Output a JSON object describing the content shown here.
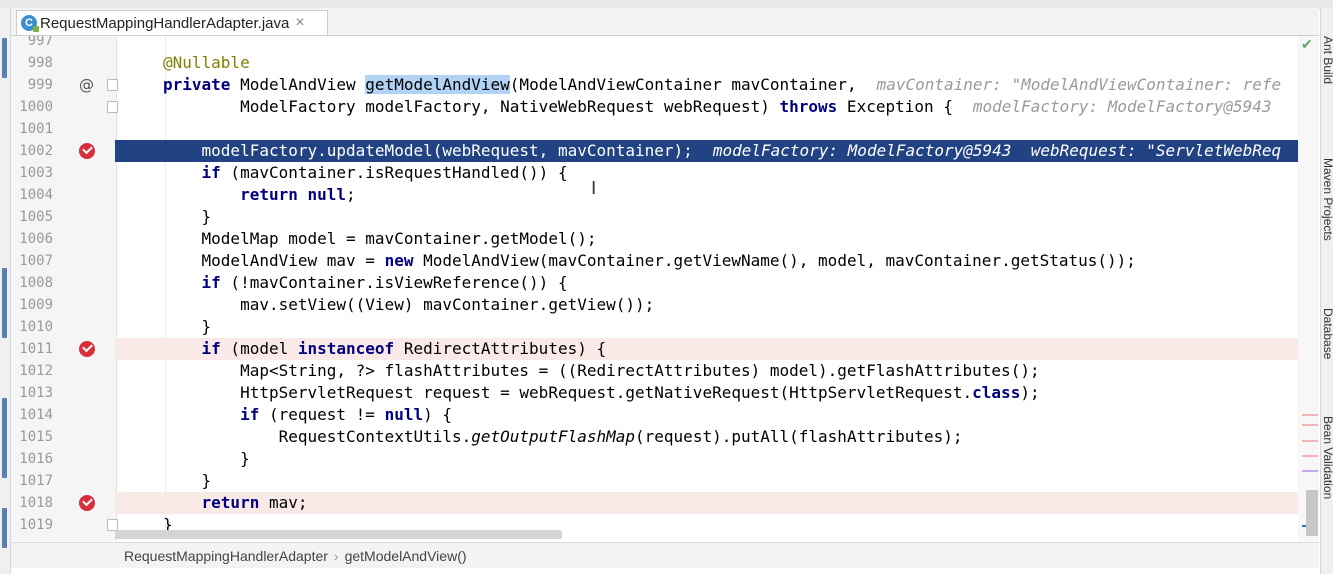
{
  "tab": {
    "icon": "java-class-icon",
    "title": "RequestMappingHandlerAdapter.java",
    "close": "×"
  },
  "editor": {
    "lines": [
      {
        "num": "997",
        "html": ""
      },
      {
        "num": "998",
        "html": "<span class=\"ann\">@Nullable</span>"
      },
      {
        "num": "999",
        "gutter_icon": "override-icon",
        "gutter_text": "@",
        "html": "<span class=\"kw\">private</span> ModelAndView <span class=\"sel\">getModelAndView</span>(ModelAndViewContainer mavContainer,<span class=\"inlay\">mavContainer: \"ModelAndViewContainer: refe</span>"
      },
      {
        "num": "1000",
        "html": "        ModelFactory modelFactory, NativeWebRequest webRequest) <span class=\"kw\">throws</span> Exception {<span class=\"inlay\">modelFactory: ModelFactory@5943</span>"
      },
      {
        "num": "1001",
        "html": ""
      },
      {
        "num": "1002",
        "gutter_icon": "breakpoint-icon",
        "highlight": true,
        "html": "    modelFactory.updateModel(webRequest, mavContainer);<span class=\"inlay\">modelFactory: ModelFactory@5943  webRequest: \"ServletWebReq</span>"
      },
      {
        "num": "1003",
        "html": "    <span class=\"kw\">if</span> (mavContainer.isRequestHandled()) {"
      },
      {
        "num": "1004",
        "html": "        <span class=\"kw\">return null</span>;"
      },
      {
        "num": "1005",
        "html": "    }"
      },
      {
        "num": "1006",
        "html": "    ModelMap model = mavContainer.getModel();"
      },
      {
        "num": "1007",
        "html": "    ModelAndView mav = <span class=\"kw\">new</span> ModelAndView(mavContainer.getViewName(), model, mavContainer.getStatus());"
      },
      {
        "num": "1008",
        "html": "    <span class=\"kw\">if</span> (!mavContainer.isViewReference()) {"
      },
      {
        "num": "1009",
        "html": "        mav.setView((View) mavContainer.getView());"
      },
      {
        "num": "1010",
        "html": "    }"
      },
      {
        "num": "1011",
        "gutter_icon": "breakpoint-icon",
        "bp": true,
        "html": "    <span class=\"kw\">if</span> (model <span class=\"kw\">instanceof</span> RedirectAttributes) {"
      },
      {
        "num": "1012",
        "html": "        Map&lt;String, ?&gt; flashAttributes = ((RedirectAttributes) model).getFlashAttributes();"
      },
      {
        "num": "1013",
        "html": "        HttpServletRequest request = webRequest.getNativeRequest(HttpServletRequest.<span class=\"kw\">class</span>);"
      },
      {
        "num": "1014",
        "html": "        <span class=\"kw\">if</span> (request != <span class=\"kw\">null</span>) {"
      },
      {
        "num": "1015",
        "html": "            RequestContextUtils.<span class=\"it\">getOutputFlashMap</span>(request).putAll(flashAttributes);"
      },
      {
        "num": "1016",
        "html": "        }"
      },
      {
        "num": "1017",
        "html": "    }"
      },
      {
        "num": "1018",
        "gutter_icon": "breakpoint-icon",
        "bp": true,
        "html": "    <span class=\"kw\">return</span> mav;"
      },
      {
        "num": "1019",
        "html": "}"
      }
    ]
  },
  "breadcrumb": {
    "class_name": "RequestMappingHandlerAdapter",
    "method_name": "getModelAndView()"
  },
  "right_tools": [
    "Ant Build",
    "Maven Projects",
    "Database",
    "Bean Validation"
  ],
  "colors": {
    "execution_line": "#214283",
    "breakpoint": "#db2e3c",
    "breakpoint_line": "#faeae7",
    "keyword": "#000080",
    "annotation": "#808000",
    "inlay": "#21c141"
  }
}
